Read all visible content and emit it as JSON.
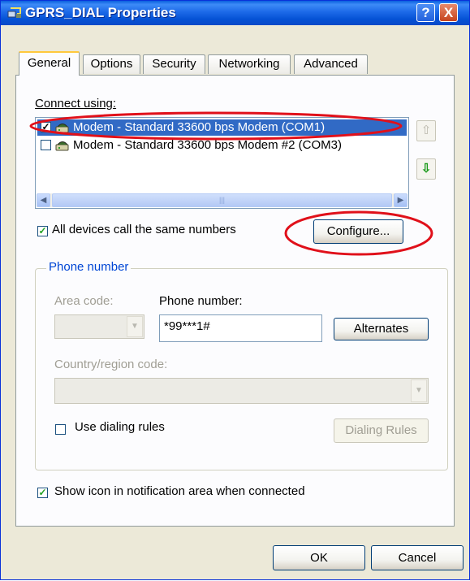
{
  "window": {
    "title": "GPRS_DIAL Properties",
    "help_label": "?",
    "close_label": "X"
  },
  "tabs": [
    {
      "label": "General",
      "active": true
    },
    {
      "label": "Options",
      "active": false
    },
    {
      "label": "Security",
      "active": false
    },
    {
      "label": "Networking",
      "active": false
    },
    {
      "label": "Advanced",
      "active": false
    }
  ],
  "general": {
    "connect_using_label": "Connect using:",
    "devices": [
      {
        "label": "Modem - Standard 33600 bps Modem (COM1)",
        "checked": true,
        "selected": true,
        "icon": "modem-icon"
      },
      {
        "label": "Modem - Standard 33600 bps Modem #2 (COM3)",
        "checked": false,
        "selected": false,
        "icon": "modem-icon"
      }
    ],
    "move_up_icon": "arrow-up-icon",
    "move_down_icon": "arrow-down-icon",
    "same_numbers_label": "All devices call the same numbers",
    "same_numbers_checked": true,
    "configure_label": "Configure...",
    "phone_group_label": "Phone number",
    "area_code_label": "Area code:",
    "phone_number_label": "Phone number:",
    "phone_number_value": "*99***1#",
    "alternates_label": "Alternates",
    "country_label": "Country/region code:",
    "dialing_rules_label": "Use dialing rules",
    "dialing_rules_checked": false,
    "dialing_rules_button": "Dialing Rules",
    "show_icon_label": "Show icon in notification area when connected",
    "show_icon_checked": true
  },
  "footer": {
    "ok_label": "OK",
    "cancel_label": "Cancel"
  },
  "colors": {
    "selection": "#316ac5",
    "annotation_ellipse": "#e0101a",
    "titlebar": "#0a5fde"
  }
}
